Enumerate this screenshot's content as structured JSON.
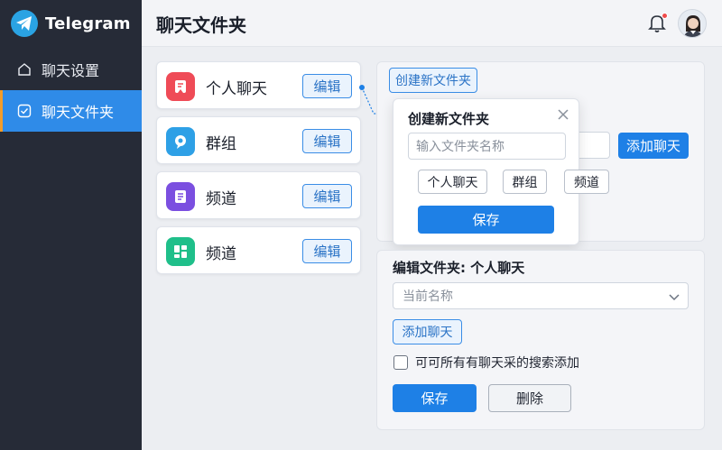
{
  "app": {
    "name": "Telegram"
  },
  "sidebar": {
    "items": [
      {
        "label": "聊天设置",
        "icon": "home-icon",
        "active": false
      },
      {
        "label": "聊天文件夹",
        "icon": "check-square-icon",
        "active": true
      }
    ]
  },
  "header": {
    "title": "聊天文件夹",
    "bell_icon": "bell-icon",
    "has_notification": true
  },
  "folders": [
    {
      "label": "个人聊天",
      "icon": "bookmark-icon",
      "color": "#ef4b57",
      "edit_label": "编辑"
    },
    {
      "label": "群组",
      "icon": "pin-bubble-icon",
      "color": "#2ea0e6",
      "edit_label": "编辑"
    },
    {
      "label": "频道",
      "icon": "document-icon",
      "color": "#7b4fe0",
      "edit_label": "编辑"
    },
    {
      "label": "频道",
      "icon": "grid-icon",
      "color": "#1fbf8a",
      "edit_label": "编辑"
    }
  ],
  "create_panel": {
    "top_button": "创建新文件夹",
    "add_chat_label": "添加聊天"
  },
  "popup": {
    "title": "创建新文件夹",
    "input_placeholder": "输入文件夹名称",
    "chips": [
      "个人聊天",
      "群组",
      "频道"
    ],
    "save_label": "保存"
  },
  "edit_panel": {
    "title": "编辑文件夹: 个人聊天",
    "select_placeholder": "当前名称",
    "add_chat_label": "添加聊天",
    "checkbox_label": "可可所有有聊天采的搜索添加",
    "checkbox_checked": false,
    "save_label": "保存",
    "delete_label": "删除"
  },
  "colors": {
    "accent": "#1e80e6",
    "sidebar_bg": "#262b37",
    "active_item": "#2f8be8"
  }
}
